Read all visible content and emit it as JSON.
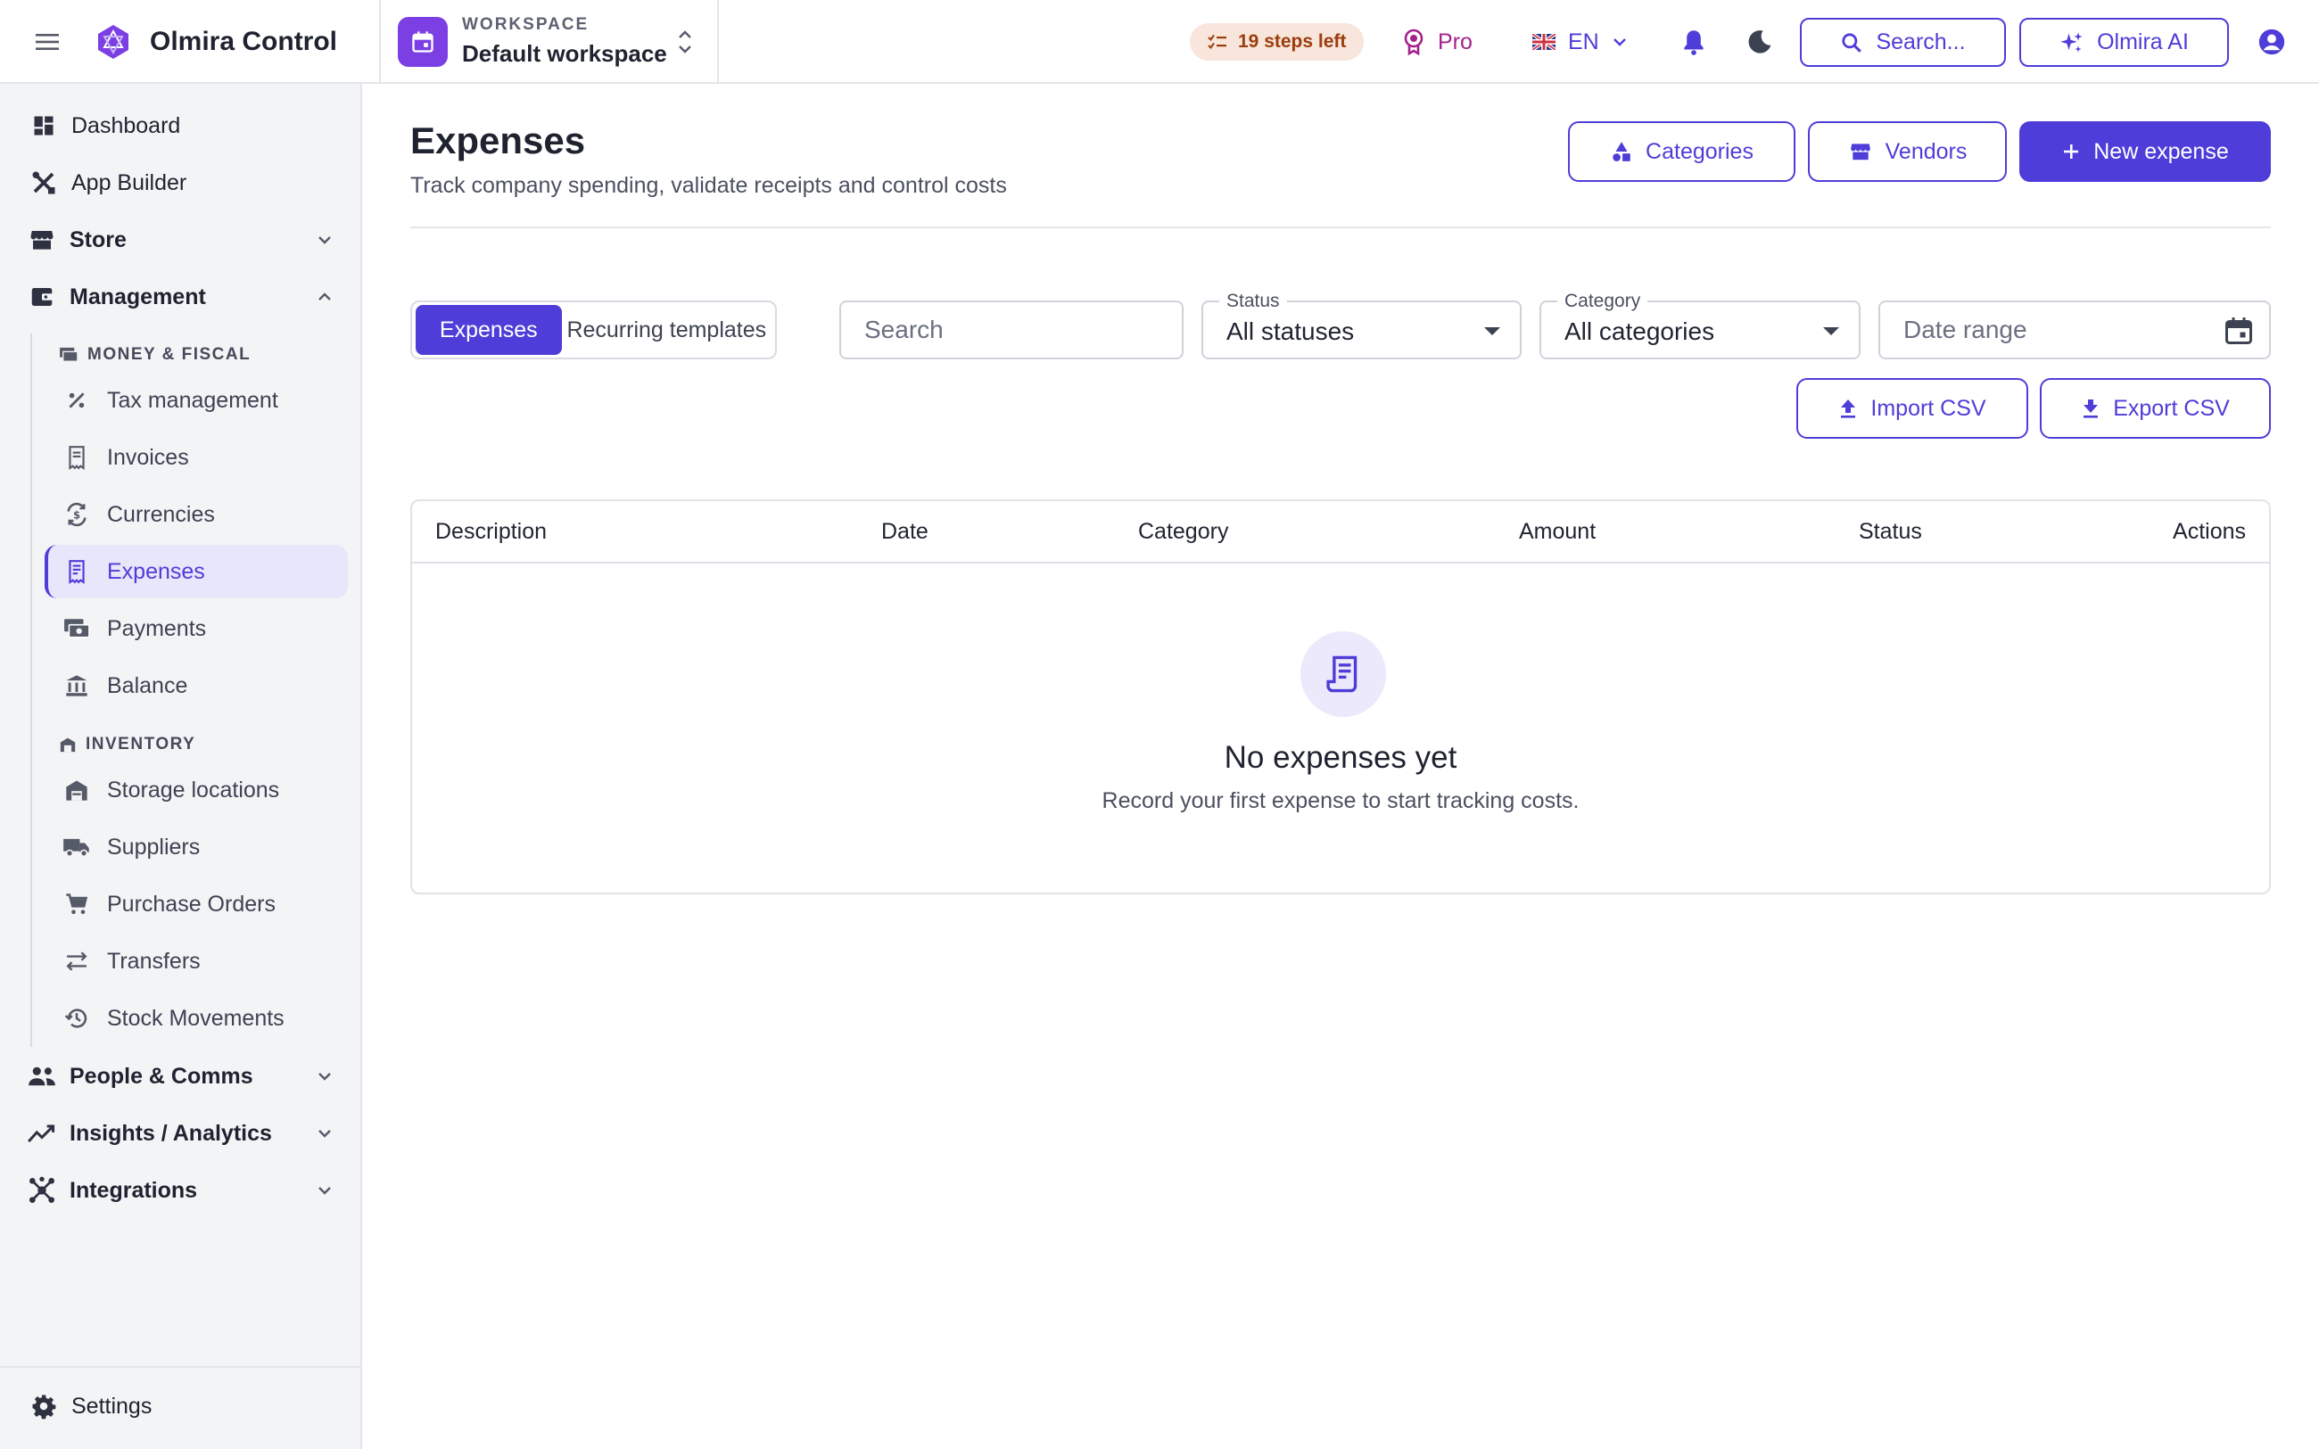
{
  "app": {
    "name": "Olmira Control"
  },
  "workspace": {
    "label": "WORKSPACE",
    "name": "Default workspace"
  },
  "topbar": {
    "steps_left": "19 steps left",
    "plan": "Pro",
    "language": "EN",
    "search_label": "Search...",
    "ai_label": "Olmira AI"
  },
  "sidebar": {
    "dashboard": "Dashboard",
    "app_builder": "App Builder",
    "store": "Store",
    "management": "Management",
    "money_section": "MONEY & FISCAL",
    "money_items": [
      "Tax management",
      "Invoices",
      "Currencies",
      "Expenses",
      "Payments",
      "Balance"
    ],
    "inventory_section": "INVENTORY",
    "inventory_items": [
      "Storage locations",
      "Suppliers",
      "Purchase Orders",
      "Transfers",
      "Stock Movements"
    ],
    "people": "People & Comms",
    "insights": "Insights / Analytics",
    "integrations": "Integrations",
    "settings": "Settings",
    "active_item": "Expenses"
  },
  "page": {
    "title": "Expenses",
    "subtitle": "Track company spending, validate receipts and control costs",
    "categories_btn": "Categories",
    "vendors_btn": "Vendors",
    "new_btn": "New expense"
  },
  "filters": {
    "tabs": [
      "Expenses",
      "Recurring templates"
    ],
    "active_tab": "Expenses",
    "search_placeholder": "Search",
    "status_label": "Status",
    "status_value": "All statuses",
    "category_label": "Category",
    "category_value": "All categories",
    "date_placeholder": "Date range",
    "import_btn": "Import CSV",
    "export_btn": "Export CSV"
  },
  "table": {
    "columns": [
      "Description",
      "Date",
      "Category",
      "Amount",
      "Status",
      "Actions"
    ],
    "rows": [],
    "empty_title": "No expenses yet",
    "empty_subtitle": "Record your first expense to start tracking costs."
  },
  "colors": {
    "accent": "#4e3dd8",
    "brand": "#7b3fe4",
    "pro": "#a4218e",
    "steps_bg": "#f8e5dc",
    "steps_text": "#9b3d0c",
    "active_bg": "#e8e6fb"
  },
  "icons": {
    "menu": "hamburger-menu-icon",
    "logo": "olmira-logo",
    "workspace": "calendar-icon",
    "steps": "checklist-icon",
    "pro": "award-badge-icon",
    "language": "uk-flag-icon",
    "bell": "bell-icon",
    "theme": "moon-icon",
    "search": "search-icon",
    "ai": "sparkles-icon",
    "account": "account-circle-icon"
  }
}
